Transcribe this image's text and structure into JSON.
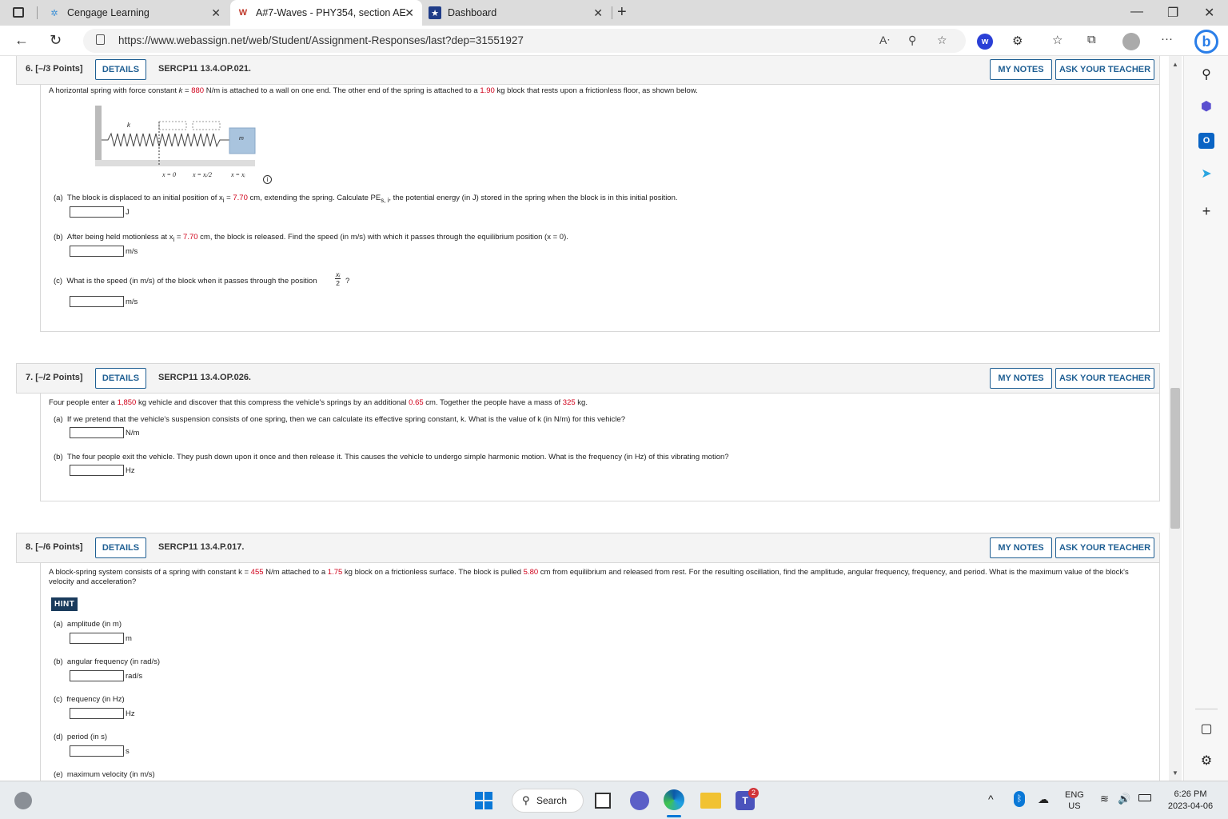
{
  "browser": {
    "tabs": [
      {
        "title": "Cengage Learning",
        "favicon": "cengage-favicon"
      },
      {
        "title": "A#7-Waves - PHY354, section AE",
        "favicon": "webassign-favicon"
      },
      {
        "title": "Dashboard",
        "favicon": "dashboard-favicon"
      }
    ],
    "url": "https://www.webassign.net/web/Student/Assignment-Responses/last?dep=31551927",
    "reader_label": "A",
    "webassign_badge": "w",
    "bing_label": "b"
  },
  "questions": {
    "q6": {
      "num": "6. [–/3 Points]",
      "details": "DETAILS",
      "code": "SERCP11 13.4.OP.021.",
      "my_notes": "MY NOTES",
      "ask": "ASK YOUR TEACHER",
      "intro_1": "A horizontal spring with force constant ",
      "intro_k": "k",
      "intro_2": " = ",
      "intro_kval": "880",
      "intro_3": " N/m is attached to a wall on one end. The other end of the spring is attached to a ",
      "intro_mass": "1.90",
      "intro_4": " kg block that rests upon a frictionless floor, as shown below.",
      "fig_k": "k",
      "fig_m": "m",
      "fig_x0": "x = 0",
      "fig_xhalf": "x = xᵢ/2",
      "fig_xi": "x = xᵢ",
      "info": "i",
      "a_label": "(a)",
      "a_text_1": "The block is displaced to an initial position of x",
      "a_sub": "i",
      "a_text_2": " = ",
      "a_val": "7.70",
      "a_text_3": " cm, extending the spring. Calculate PE",
      "a_sub2": "s, i",
      "a_text_4": ", the potential energy (in J) stored in the spring when the block is in this initial position.",
      "a_unit": "J",
      "b_label": "(b)",
      "b_text_1": "After being held motionless at x",
      "b_sub": "i",
      "b_text_2": " = ",
      "b_val": "7.70",
      "b_text_3": " cm, the block is released. Find the speed (in m/s) with which it passes through the equilibrium position (x = 0).",
      "b_unit": "m/s",
      "c_label": "(c)",
      "c_text": "What is the speed (in m/s) of the block when it passes through the position",
      "c_num": "xᵢ",
      "c_den": "2",
      "c_q": "?",
      "c_unit": "m/s"
    },
    "q7": {
      "num": "7. [–/2 Points]",
      "details": "DETAILS",
      "code": "SERCP11 13.4.OP.026.",
      "my_notes": "MY NOTES",
      "ask": "ASK YOUR TEACHER",
      "intro_1": "Four people enter a ",
      "intro_mass": "1,850",
      "intro_2": " kg vehicle and discover that this compress the vehicle's springs by an additional ",
      "intro_disp": "0.65",
      "intro_3": " cm. Together the people have a mass of ",
      "intro_pmass": "325",
      "intro_4": " kg.",
      "a_label": "(a)",
      "a_text": "If we pretend that the vehicle's suspension consists of one spring, then we can calculate its effective spring constant, k. What is the value of k (in N/m) for this vehicle?",
      "a_unit": "N/m",
      "b_label": "(b)",
      "b_text": "The four people exit the vehicle. They push down upon it once and then release it. This causes the vehicle to undergo simple harmonic motion. What is the frequency (in Hz) of this vibrating motion?",
      "b_unit": "Hz"
    },
    "q8": {
      "num": "8. [–/6 Points]",
      "details": "DETAILS",
      "code": "SERCP11 13.4.P.017.",
      "my_notes": "MY NOTES",
      "ask": "ASK YOUR TEACHER",
      "intro_1": "A block-spring system consists of a spring with constant k = ",
      "intro_k": "455",
      "intro_2": " N/m attached to a ",
      "intro_mass": "1.75",
      "intro_3": " kg block on a frictionless surface. The block is pulled ",
      "intro_disp": "5.80",
      "intro_4": " cm from equilibrium and released from rest. For the resulting oscillation, find the amplitude, angular frequency, frequency, and period. What is the maximum value of the block's velocity and acceleration?",
      "hint": "HINT",
      "parts": [
        {
          "label": "(a)",
          "text": "amplitude (in m)",
          "unit": "m"
        },
        {
          "label": "(b)",
          "text": "angular frequency (in rad/s)",
          "unit": "rad/s"
        },
        {
          "label": "(c)",
          "text": "frequency (in Hz)",
          "unit": "Hz"
        },
        {
          "label": "(d)",
          "text": "period (in s)",
          "unit": "s"
        },
        {
          "label": "(e)",
          "text": "maximum velocity (in m/s)",
          "unit": ""
        }
      ]
    }
  },
  "taskbar": {
    "search": "Search",
    "teams_badge": "2",
    "lang_1": "ENG",
    "lang_2": "US",
    "time": "6:26 PM",
    "date": "2023-04-06"
  },
  "colors": {
    "link_blue": "#1f5f93",
    "value_red": "#d0021b",
    "hint_bg": "#1a3b5c"
  }
}
